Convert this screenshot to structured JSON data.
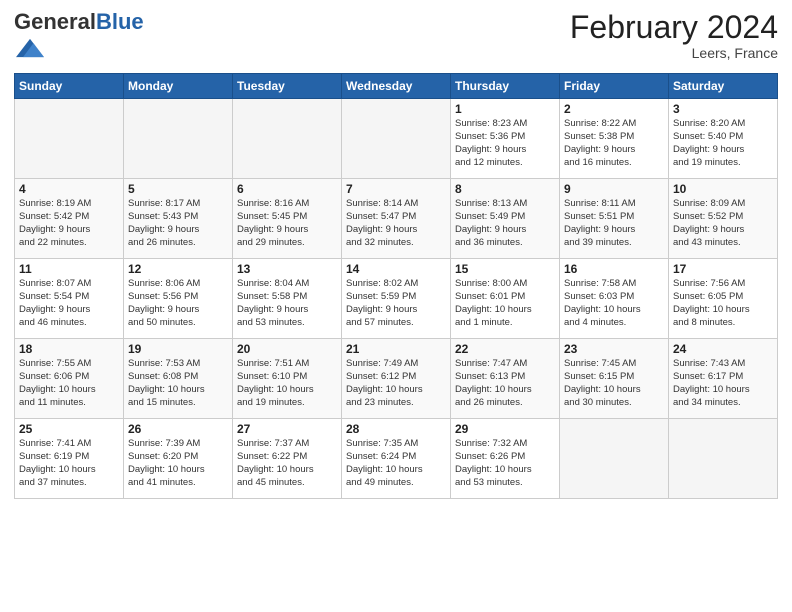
{
  "header": {
    "logo_general": "General",
    "logo_blue": "Blue",
    "month_year": "February 2024",
    "location": "Leers, France"
  },
  "days_of_week": [
    "Sunday",
    "Monday",
    "Tuesday",
    "Wednesday",
    "Thursday",
    "Friday",
    "Saturday"
  ],
  "weeks": [
    [
      {
        "day": "",
        "content": ""
      },
      {
        "day": "",
        "content": ""
      },
      {
        "day": "",
        "content": ""
      },
      {
        "day": "",
        "content": ""
      },
      {
        "day": "1",
        "content": "Sunrise: 8:23 AM\nSunset: 5:36 PM\nDaylight: 9 hours\nand 12 minutes."
      },
      {
        "day": "2",
        "content": "Sunrise: 8:22 AM\nSunset: 5:38 PM\nDaylight: 9 hours\nand 16 minutes."
      },
      {
        "day": "3",
        "content": "Sunrise: 8:20 AM\nSunset: 5:40 PM\nDaylight: 9 hours\nand 19 minutes."
      }
    ],
    [
      {
        "day": "4",
        "content": "Sunrise: 8:19 AM\nSunset: 5:42 PM\nDaylight: 9 hours\nand 22 minutes."
      },
      {
        "day": "5",
        "content": "Sunrise: 8:17 AM\nSunset: 5:43 PM\nDaylight: 9 hours\nand 26 minutes."
      },
      {
        "day": "6",
        "content": "Sunrise: 8:16 AM\nSunset: 5:45 PM\nDaylight: 9 hours\nand 29 minutes."
      },
      {
        "day": "7",
        "content": "Sunrise: 8:14 AM\nSunset: 5:47 PM\nDaylight: 9 hours\nand 32 minutes."
      },
      {
        "day": "8",
        "content": "Sunrise: 8:13 AM\nSunset: 5:49 PM\nDaylight: 9 hours\nand 36 minutes."
      },
      {
        "day": "9",
        "content": "Sunrise: 8:11 AM\nSunset: 5:51 PM\nDaylight: 9 hours\nand 39 minutes."
      },
      {
        "day": "10",
        "content": "Sunrise: 8:09 AM\nSunset: 5:52 PM\nDaylight: 9 hours\nand 43 minutes."
      }
    ],
    [
      {
        "day": "11",
        "content": "Sunrise: 8:07 AM\nSunset: 5:54 PM\nDaylight: 9 hours\nand 46 minutes."
      },
      {
        "day": "12",
        "content": "Sunrise: 8:06 AM\nSunset: 5:56 PM\nDaylight: 9 hours\nand 50 minutes."
      },
      {
        "day": "13",
        "content": "Sunrise: 8:04 AM\nSunset: 5:58 PM\nDaylight: 9 hours\nand 53 minutes."
      },
      {
        "day": "14",
        "content": "Sunrise: 8:02 AM\nSunset: 5:59 PM\nDaylight: 9 hours\nand 57 minutes."
      },
      {
        "day": "15",
        "content": "Sunrise: 8:00 AM\nSunset: 6:01 PM\nDaylight: 10 hours\nand 1 minute."
      },
      {
        "day": "16",
        "content": "Sunrise: 7:58 AM\nSunset: 6:03 PM\nDaylight: 10 hours\nand 4 minutes."
      },
      {
        "day": "17",
        "content": "Sunrise: 7:56 AM\nSunset: 6:05 PM\nDaylight: 10 hours\nand 8 minutes."
      }
    ],
    [
      {
        "day": "18",
        "content": "Sunrise: 7:55 AM\nSunset: 6:06 PM\nDaylight: 10 hours\nand 11 minutes."
      },
      {
        "day": "19",
        "content": "Sunrise: 7:53 AM\nSunset: 6:08 PM\nDaylight: 10 hours\nand 15 minutes."
      },
      {
        "day": "20",
        "content": "Sunrise: 7:51 AM\nSunset: 6:10 PM\nDaylight: 10 hours\nand 19 minutes."
      },
      {
        "day": "21",
        "content": "Sunrise: 7:49 AM\nSunset: 6:12 PM\nDaylight: 10 hours\nand 23 minutes."
      },
      {
        "day": "22",
        "content": "Sunrise: 7:47 AM\nSunset: 6:13 PM\nDaylight: 10 hours\nand 26 minutes."
      },
      {
        "day": "23",
        "content": "Sunrise: 7:45 AM\nSunset: 6:15 PM\nDaylight: 10 hours\nand 30 minutes."
      },
      {
        "day": "24",
        "content": "Sunrise: 7:43 AM\nSunset: 6:17 PM\nDaylight: 10 hours\nand 34 minutes."
      }
    ],
    [
      {
        "day": "25",
        "content": "Sunrise: 7:41 AM\nSunset: 6:19 PM\nDaylight: 10 hours\nand 37 minutes."
      },
      {
        "day": "26",
        "content": "Sunrise: 7:39 AM\nSunset: 6:20 PM\nDaylight: 10 hours\nand 41 minutes."
      },
      {
        "day": "27",
        "content": "Sunrise: 7:37 AM\nSunset: 6:22 PM\nDaylight: 10 hours\nand 45 minutes."
      },
      {
        "day": "28",
        "content": "Sunrise: 7:35 AM\nSunset: 6:24 PM\nDaylight: 10 hours\nand 49 minutes."
      },
      {
        "day": "29",
        "content": "Sunrise: 7:32 AM\nSunset: 6:26 PM\nDaylight: 10 hours\nand 53 minutes."
      },
      {
        "day": "",
        "content": ""
      },
      {
        "day": "",
        "content": ""
      }
    ]
  ]
}
